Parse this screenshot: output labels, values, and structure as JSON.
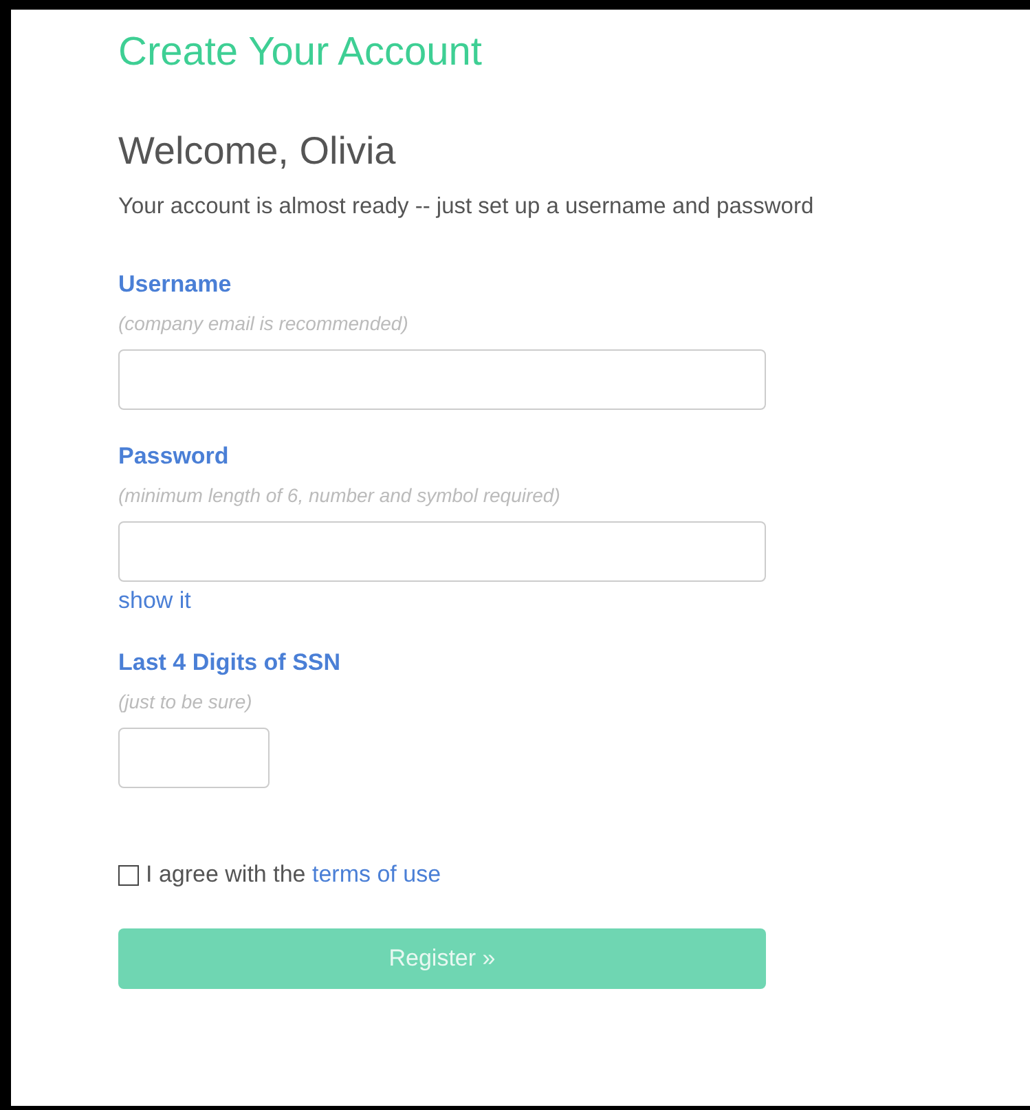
{
  "title": "Create Your Account",
  "greeting": "Welcome, Olivia",
  "intro": "Your account is almost ready -- just set up a username and password",
  "fields": [
    {
      "kind": "wide",
      "label": "Username",
      "hint": "(company email is recommended)"
    },
    {
      "kind": "wide",
      "label": "Password",
      "hint": "(minimum length of 6, number and symbol required)",
      "link": "show it"
    },
    {
      "kind": "short",
      "label": "Last 4 Digits of SSN",
      "hint": "(just to be sure)"
    }
  ],
  "agree": {
    "text": "I agree with the",
    "link": "terms of use",
    "checked": false
  },
  "register_button": {
    "label": "Register »",
    "disabled": true
  }
}
